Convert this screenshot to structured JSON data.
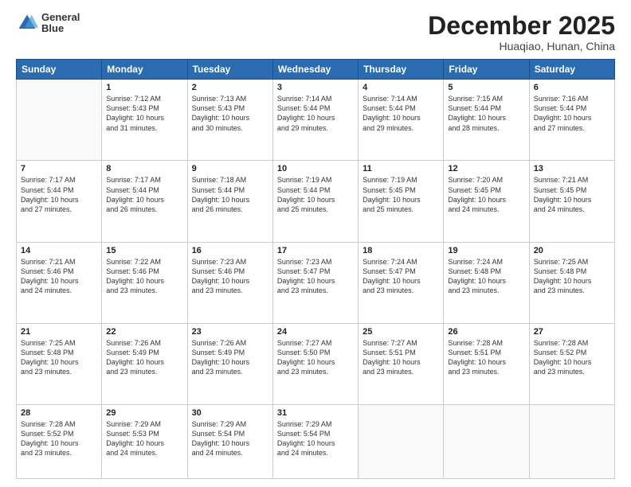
{
  "header": {
    "logo_line1": "General",
    "logo_line2": "Blue",
    "month": "December 2025",
    "location": "Huaqiao, Hunan, China"
  },
  "weekdays": [
    "Sunday",
    "Monday",
    "Tuesday",
    "Wednesday",
    "Thursday",
    "Friday",
    "Saturday"
  ],
  "weeks": [
    [
      {
        "num": "",
        "info": ""
      },
      {
        "num": "1",
        "info": "Sunrise: 7:12 AM\nSunset: 5:43 PM\nDaylight: 10 hours\nand 31 minutes."
      },
      {
        "num": "2",
        "info": "Sunrise: 7:13 AM\nSunset: 5:43 PM\nDaylight: 10 hours\nand 30 minutes."
      },
      {
        "num": "3",
        "info": "Sunrise: 7:14 AM\nSunset: 5:44 PM\nDaylight: 10 hours\nand 29 minutes."
      },
      {
        "num": "4",
        "info": "Sunrise: 7:14 AM\nSunset: 5:44 PM\nDaylight: 10 hours\nand 29 minutes."
      },
      {
        "num": "5",
        "info": "Sunrise: 7:15 AM\nSunset: 5:44 PM\nDaylight: 10 hours\nand 28 minutes."
      },
      {
        "num": "6",
        "info": "Sunrise: 7:16 AM\nSunset: 5:44 PM\nDaylight: 10 hours\nand 27 minutes."
      }
    ],
    [
      {
        "num": "7",
        "info": "Sunrise: 7:17 AM\nSunset: 5:44 PM\nDaylight: 10 hours\nand 27 minutes."
      },
      {
        "num": "8",
        "info": "Sunrise: 7:17 AM\nSunset: 5:44 PM\nDaylight: 10 hours\nand 26 minutes."
      },
      {
        "num": "9",
        "info": "Sunrise: 7:18 AM\nSunset: 5:44 PM\nDaylight: 10 hours\nand 26 minutes."
      },
      {
        "num": "10",
        "info": "Sunrise: 7:19 AM\nSunset: 5:44 PM\nDaylight: 10 hours\nand 25 minutes."
      },
      {
        "num": "11",
        "info": "Sunrise: 7:19 AM\nSunset: 5:45 PM\nDaylight: 10 hours\nand 25 minutes."
      },
      {
        "num": "12",
        "info": "Sunrise: 7:20 AM\nSunset: 5:45 PM\nDaylight: 10 hours\nand 24 minutes."
      },
      {
        "num": "13",
        "info": "Sunrise: 7:21 AM\nSunset: 5:45 PM\nDaylight: 10 hours\nand 24 minutes."
      }
    ],
    [
      {
        "num": "14",
        "info": "Sunrise: 7:21 AM\nSunset: 5:46 PM\nDaylight: 10 hours\nand 24 minutes."
      },
      {
        "num": "15",
        "info": "Sunrise: 7:22 AM\nSunset: 5:46 PM\nDaylight: 10 hours\nand 23 minutes."
      },
      {
        "num": "16",
        "info": "Sunrise: 7:23 AM\nSunset: 5:46 PM\nDaylight: 10 hours\nand 23 minutes."
      },
      {
        "num": "17",
        "info": "Sunrise: 7:23 AM\nSunset: 5:47 PM\nDaylight: 10 hours\nand 23 minutes."
      },
      {
        "num": "18",
        "info": "Sunrise: 7:24 AM\nSunset: 5:47 PM\nDaylight: 10 hours\nand 23 minutes."
      },
      {
        "num": "19",
        "info": "Sunrise: 7:24 AM\nSunset: 5:48 PM\nDaylight: 10 hours\nand 23 minutes."
      },
      {
        "num": "20",
        "info": "Sunrise: 7:25 AM\nSunset: 5:48 PM\nDaylight: 10 hours\nand 23 minutes."
      }
    ],
    [
      {
        "num": "21",
        "info": "Sunrise: 7:25 AM\nSunset: 5:48 PM\nDaylight: 10 hours\nand 23 minutes."
      },
      {
        "num": "22",
        "info": "Sunrise: 7:26 AM\nSunset: 5:49 PM\nDaylight: 10 hours\nand 23 minutes."
      },
      {
        "num": "23",
        "info": "Sunrise: 7:26 AM\nSunset: 5:49 PM\nDaylight: 10 hours\nand 23 minutes."
      },
      {
        "num": "24",
        "info": "Sunrise: 7:27 AM\nSunset: 5:50 PM\nDaylight: 10 hours\nand 23 minutes."
      },
      {
        "num": "25",
        "info": "Sunrise: 7:27 AM\nSunset: 5:51 PM\nDaylight: 10 hours\nand 23 minutes."
      },
      {
        "num": "26",
        "info": "Sunrise: 7:28 AM\nSunset: 5:51 PM\nDaylight: 10 hours\nand 23 minutes."
      },
      {
        "num": "27",
        "info": "Sunrise: 7:28 AM\nSunset: 5:52 PM\nDaylight: 10 hours\nand 23 minutes."
      }
    ],
    [
      {
        "num": "28",
        "info": "Sunrise: 7:28 AM\nSunset: 5:52 PM\nDaylight: 10 hours\nand 23 minutes."
      },
      {
        "num": "29",
        "info": "Sunrise: 7:29 AM\nSunset: 5:53 PM\nDaylight: 10 hours\nand 24 minutes."
      },
      {
        "num": "30",
        "info": "Sunrise: 7:29 AM\nSunset: 5:54 PM\nDaylight: 10 hours\nand 24 minutes."
      },
      {
        "num": "31",
        "info": "Sunrise: 7:29 AM\nSunset: 5:54 PM\nDaylight: 10 hours\nand 24 minutes."
      },
      {
        "num": "",
        "info": ""
      },
      {
        "num": "",
        "info": ""
      },
      {
        "num": "",
        "info": ""
      }
    ]
  ]
}
